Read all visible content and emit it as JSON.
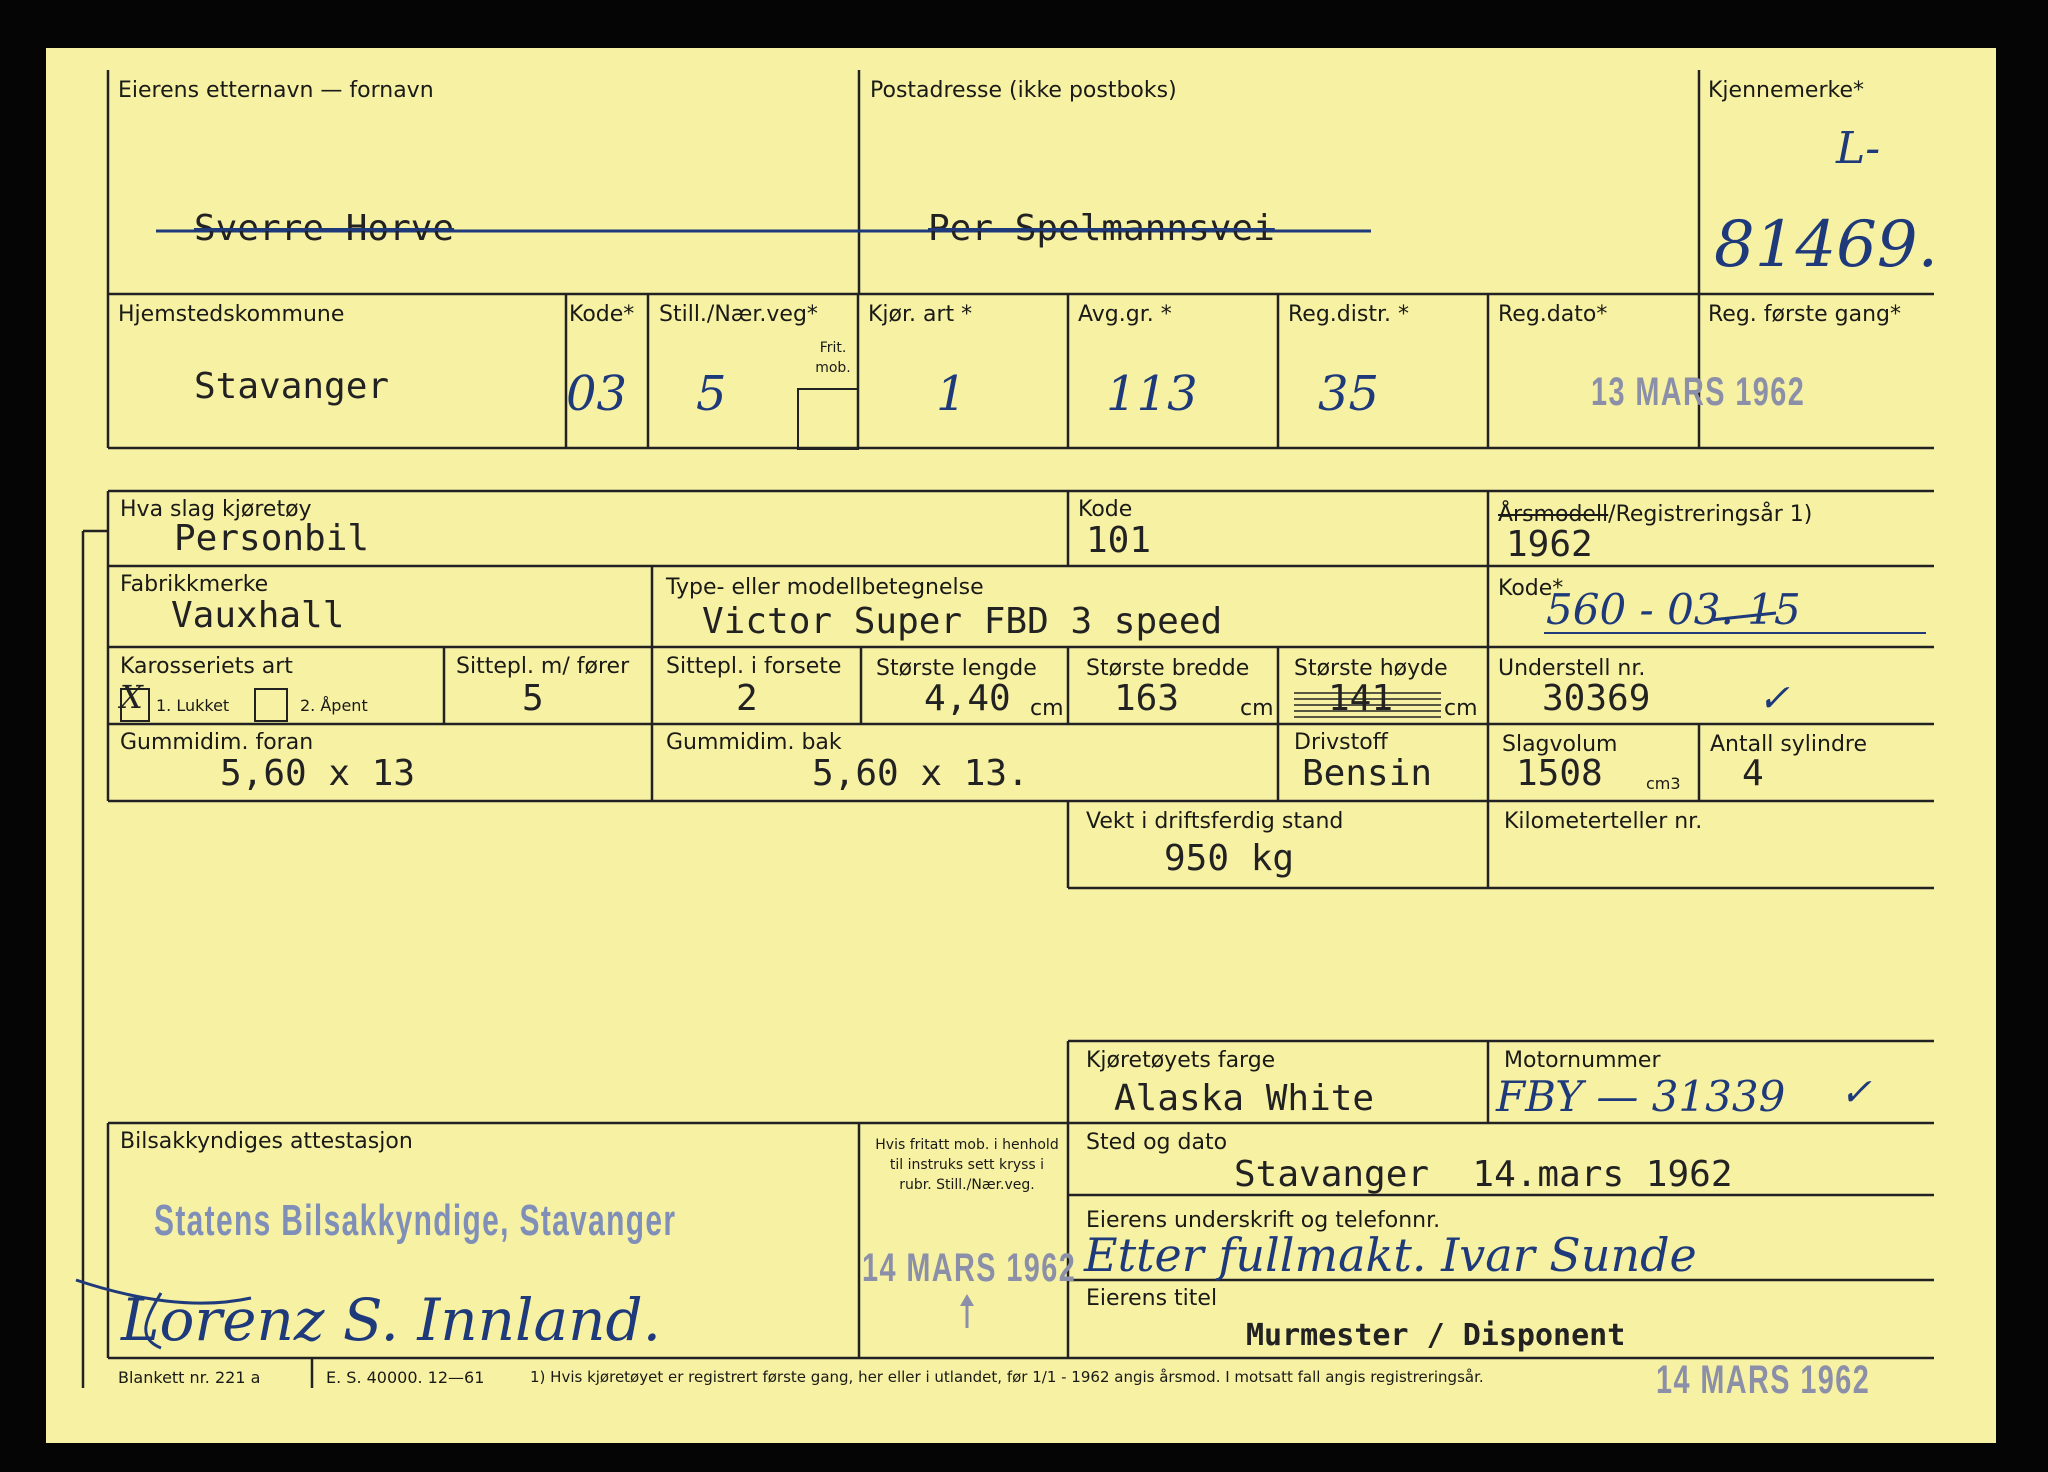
{
  "owner": {
    "name_label": "Eierens etternavn — fornavn",
    "name_value": "Sverre Horve",
    "address_label": "Postadresse (ikke postboks)",
    "address_value": "Per Spelmannsvei",
    "regmark_label": "Kjennemerke*",
    "regmark_prefix": "L-",
    "regmark_value": "81469."
  },
  "registration": {
    "kommune_label": "Hjemstedskommune",
    "kommune_value": "Stavanger",
    "kode_label": "Kode*",
    "kode_value": "03",
    "still_label": "Still./Nær.veg*",
    "still_value": "5",
    "frit_label": "Frit. mob.",
    "kjor_label": "Kjør. art *",
    "kjor_value": "1",
    "avg_label": "Avg.gr. *",
    "avg_value": "113",
    "distr_label": "Reg.distr. *",
    "distr_value": "35",
    "dato_label": "Reg.dato*",
    "dato_value": "13 MARS 1962",
    "forste_label": "Reg. første gang*"
  },
  "vehicle": {
    "type_label": "Hva slag kjøretøy",
    "type_value": "Personbil",
    "kode_label": "Kode",
    "kode_value": "101",
    "year_label_struck": "Årsmodell",
    "year_label_rest": "/Registreringsår 1)",
    "year_value": "1962",
    "make_label": "Fabrikkmerke",
    "make_value": "Vauxhall",
    "model_label": "Type- eller modellbetegnelse",
    "model_value": "Victor Super FBD 3 speed",
    "code2_label": "Kode*",
    "code2_value_a": "560 - ",
    "code2_value_b": "03",
    "code2_value_c": ". 15",
    "body_label": "Karosseriets art",
    "body_mark": "X",
    "body_opt1": "1. Lukket",
    "body_opt2": "2. Åpent",
    "seats_label": "Sittepl. m/ fører",
    "seats_value": "5",
    "front_label": "Sittepl. i forsete",
    "front_value": "2",
    "length_label": "Største lengde",
    "length_value": "4,40",
    "length_unit": "cm",
    "width_label": "Største bredde",
    "width_value": "163",
    "width_unit": "cm",
    "height_label": "Største høyde",
    "height_value": "141",
    "height_unit": "cm",
    "chassis_label": "Understell nr.",
    "chassis_value": "30369",
    "check": "✓",
    "tire_front_label": "Gummidim. foran",
    "tire_front_value": "5,60 x 13",
    "tire_rear_label": "Gummidim. bak",
    "tire_rear_value": "5,60 x 13.",
    "fuel_label": "Drivstoff",
    "fuel_value": "Bensin",
    "volume_label": "Slagvolum",
    "volume_value": "1508",
    "volume_unit": "cm3",
    "cyl_label": "Antall sylindre",
    "cyl_value": "4",
    "weight_label": "Vekt i driftsferdig stand",
    "weight_value": "950 kg",
    "km_label": "Kilometerteller nr.",
    "color_label": "Kjøretøyets farge",
    "color_value": "Alaska White",
    "engine_label": "Motornummer",
    "engine_value": "FBY — 31339"
  },
  "attest": {
    "label": "Bilsakkyndiges attestasjon",
    "stamp_text": "Statens Bilsakkyndige, Stavanger",
    "signature": "Lorenz S. Innland.",
    "note": "Hvis fritatt mob. i henhold til instruks sett kryss i rubr. Still./Nær.veg.",
    "stamp_date": "14 MARS 1962",
    "place_label": "Sted og dato",
    "place_value": "Stavanger  14.mars 1962",
    "owner_sig_label": "Eierens underskrift og telefonnr.",
    "owner_sig_value": "Etter fullmakt. Ivar Sunde",
    "title_label": "Eierens titel",
    "title_value": "Murmester / Disponent"
  },
  "footer": {
    "blankett": "Blankett nr. 221 a",
    "es": "E. S. 40000.  12—61",
    "note": "1)  Hvis kjøretøyet er registrert første gang, her eller i utlandet, før 1/1 - 1962 angis årsmod.  I motsatt fall angis registreringsår.",
    "stamp": "14 MARS 1962"
  }
}
